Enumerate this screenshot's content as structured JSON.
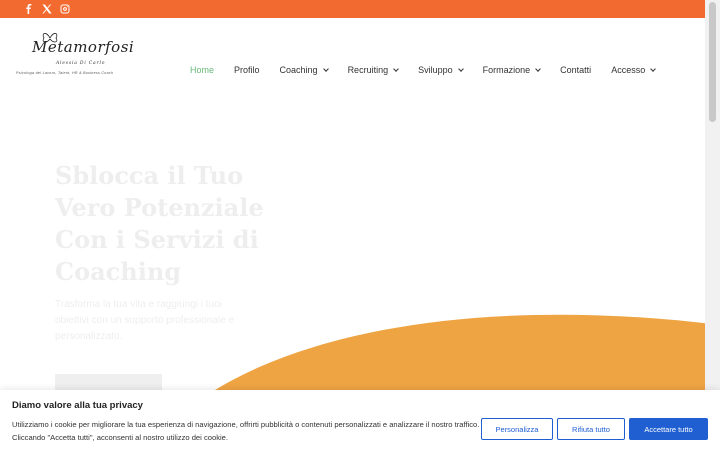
{
  "social": {
    "facebook_icon": "facebook-icon",
    "x_icon": "x-twitter-icon",
    "instagram_icon": "instagram-icon",
    "bar_color": "#f26a30"
  },
  "logo": {
    "title": "Metamorfosi",
    "name": "Alessia Di Carlo",
    "tagline": "Psicologa del Lavoro, Talent, HR & Business Coach"
  },
  "nav": {
    "items": [
      {
        "label": "Home",
        "active": true,
        "dropdown": false
      },
      {
        "label": "Profilo",
        "active": false,
        "dropdown": false
      },
      {
        "label": "Coaching",
        "active": false,
        "dropdown": true
      },
      {
        "label": "Recruiting",
        "active": false,
        "dropdown": true
      },
      {
        "label": "Sviluppo",
        "active": false,
        "dropdown": true
      },
      {
        "label": "Formazione",
        "active": false,
        "dropdown": true
      },
      {
        "label": "Contatti",
        "active": false,
        "dropdown": false
      },
      {
        "label": "Accesso",
        "active": false,
        "dropdown": true
      }
    ],
    "active_color": "#6cb87c"
  },
  "hero": {
    "title": "Sblocca il Tuo Vero Potenziale Con i Servizi di Coaching",
    "text": "Trasforma la tua vita e raggiungi i tuoi obiettivi con un supporto professionale e personalizzato.",
    "wave_color": "#efa443"
  },
  "cookie": {
    "title": "Diamo valore alla tua privacy",
    "text": "Utilizziamo i cookie per migliorare la tua esperienza di navigazione, offrirti pubblicità o contenuti personalizzati e analizzare il nostro traffico. Cliccando \"Accetta tutti\", acconsenti al nostro utilizzo dei cookie.",
    "customize_label": "Personalizza",
    "reject_label": "Rifiuta tutto",
    "accept_label": "Accettare tutto",
    "accent_color": "#1f5fd1"
  }
}
